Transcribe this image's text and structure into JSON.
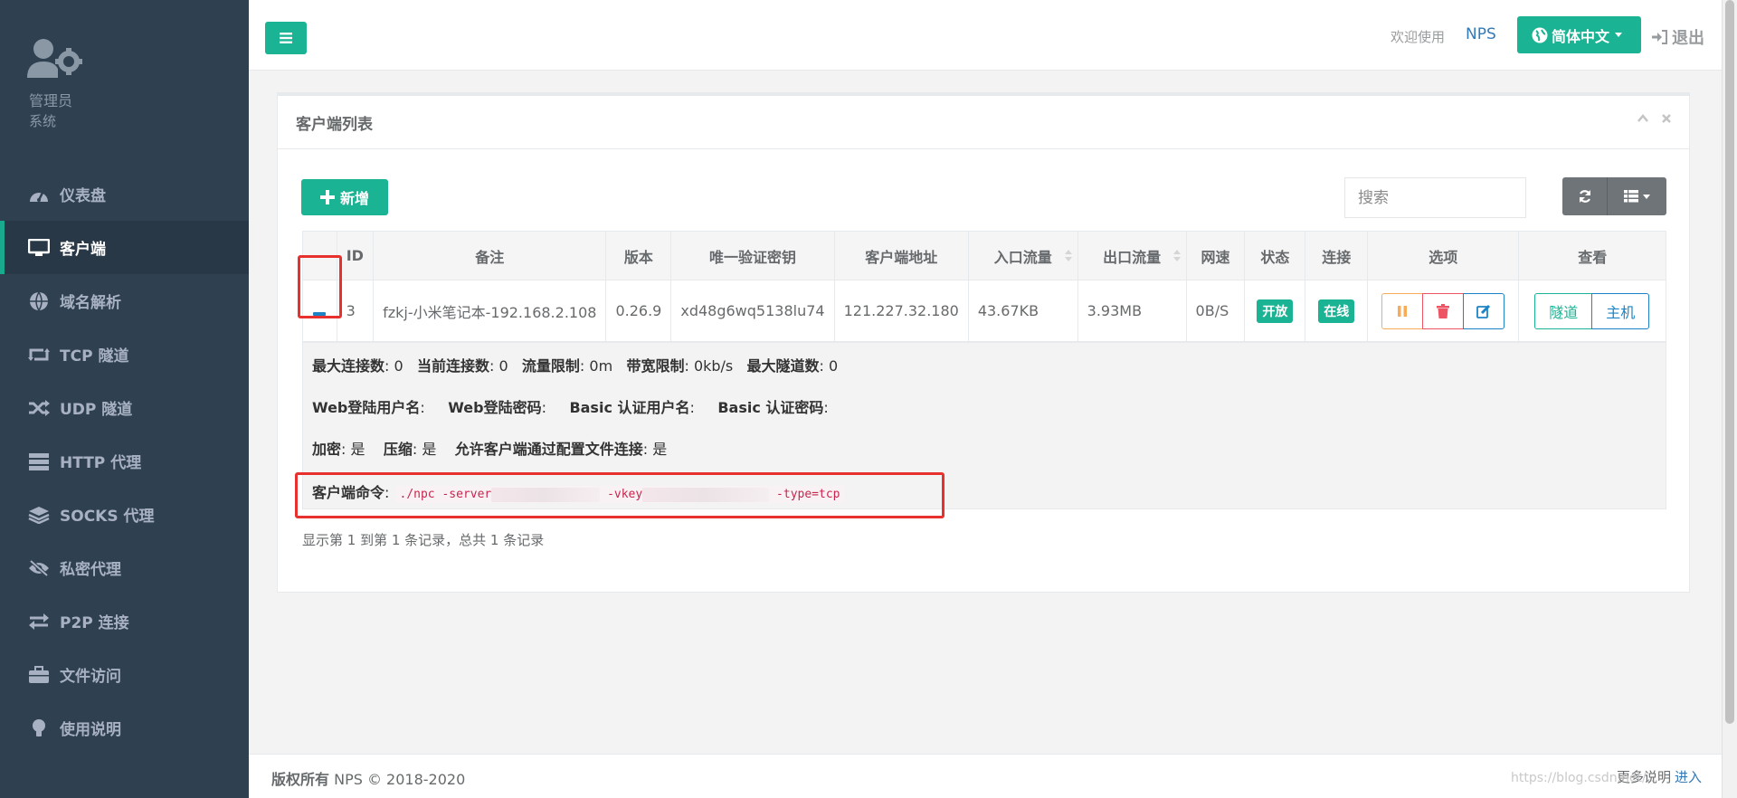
{
  "profile": {
    "role": "管理员",
    "subtitle": "系统"
  },
  "sidebar": {
    "items": [
      {
        "label": "仪表盘",
        "icon": "dashboard-icon"
      },
      {
        "label": "客户端",
        "icon": "desktop-icon",
        "active": true
      },
      {
        "label": "域名解析",
        "icon": "globe-icon"
      },
      {
        "label": "TCP 隧道",
        "icon": "retweet-icon"
      },
      {
        "label": "UDP 隧道",
        "icon": "random-icon"
      },
      {
        "label": "HTTP 代理",
        "icon": "server-icon"
      },
      {
        "label": "SOCKS 代理",
        "icon": "layers-icon"
      },
      {
        "label": "私密代理",
        "icon": "eye-slash-icon"
      },
      {
        "label": "P2P 连接",
        "icon": "exchange-icon"
      },
      {
        "label": "文件访问",
        "icon": "briefcase-icon"
      },
      {
        "label": "使用说明",
        "icon": "lightbulb-icon"
      }
    ]
  },
  "header": {
    "welcome": "欢迎使用",
    "app_name": "NPS",
    "language": "简体中文",
    "logout": "退出"
  },
  "panel": {
    "title": "客户端列表",
    "add_label": "新增",
    "search_placeholder": "搜索"
  },
  "table": {
    "columns": [
      "ID",
      "备注",
      "版本",
      "唯一验证密钥",
      "客户端地址",
      "入口流量",
      "出口流量",
      "网速",
      "状态",
      "连接",
      "选项",
      "查看"
    ],
    "rows": [
      {
        "id": "3",
        "remark": "fzkj-小米笔记本-192.168.2.108",
        "version": "0.26.9",
        "vkey": "xd48g6wq5138lu74",
        "address": "121.227.32.180",
        "inflow": "43.67KB",
        "outflow": "3.93MB",
        "speed": "0B/S",
        "status": "开放",
        "connection": "在线",
        "view_tunnel": "隧道",
        "view_host": "主机"
      }
    ]
  },
  "detail": {
    "max_conn_label": "最大连接数",
    "max_conn": "0",
    "cur_conn_label": "当前连接数",
    "cur_conn": "0",
    "flow_limit_label": "流量限制",
    "flow_limit": "0m",
    "rate_limit_label": "带宽限制",
    "rate_limit": "0kb/s",
    "max_tunnel_label": "最大隧道数",
    "max_tunnel": "0",
    "web_user_label": "Web登陆用户名",
    "web_pass_label": "Web登陆密码",
    "basic_user_label": "Basic 认证用户名",
    "basic_pass_label": "Basic 认证密码",
    "crypt_label": "加密",
    "crypt": "是",
    "compress_label": "压缩",
    "compress": "是",
    "config_conn_label": "允许客户端通过配置文件连接",
    "config_conn": "是",
    "cmd_label": "客户端命令",
    "cmd_part1": "./npc -server",
    "cmd_part2": "-vkey",
    "cmd_part3": "-type=tcp"
  },
  "pagination": {
    "info": "显示第 1 到第 1 条记录，总共 1 条记录"
  },
  "footer": {
    "copyright_label": "版权所有",
    "copyright": "NPS © 2018-2020",
    "more_label": "更多说明",
    "enter_label": "进入",
    "watermark": "https://blog.csdn.net/..."
  },
  "colors": {
    "sidebar": "#2f4050",
    "primary": "#1ab394",
    "info": "#1c84c6",
    "warning": "#f8ac59",
    "danger": "#ed5565",
    "highlight": "#e8312f"
  }
}
